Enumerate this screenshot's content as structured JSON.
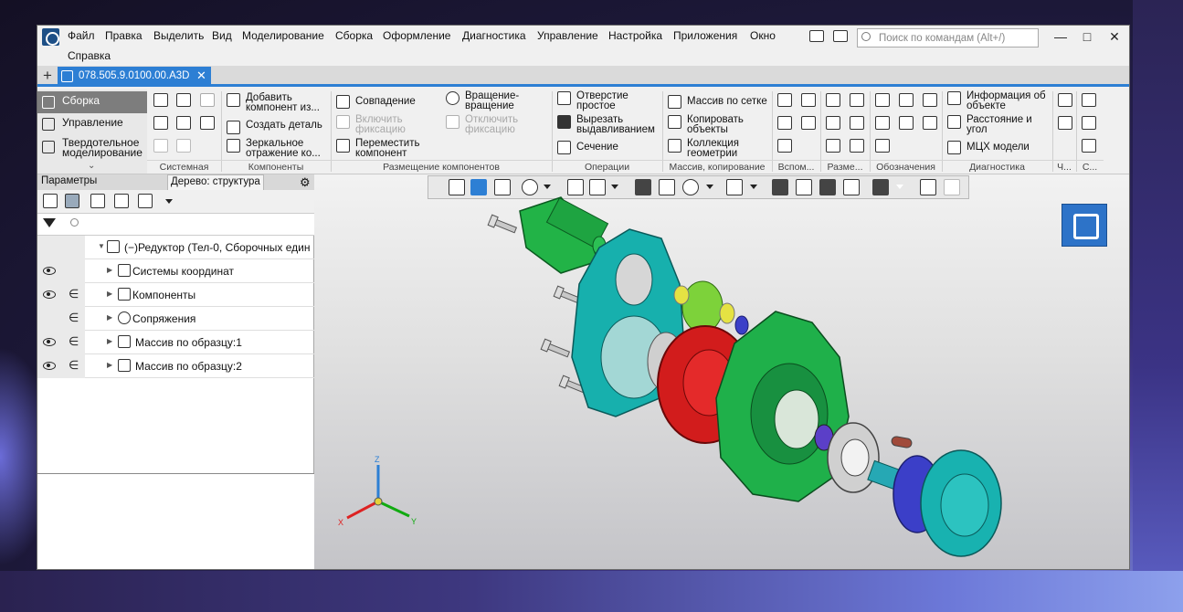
{
  "menu": {
    "items": [
      "Файл",
      "Правка",
      "Выделить",
      "Вид",
      "Моделирование",
      "Сборка",
      "Оформление",
      "Диагностика",
      "Управление",
      "Настройка",
      "Приложения",
      "Окно"
    ],
    "help": "Справка"
  },
  "search": {
    "placeholder": "Поиск по командам (Alt+/)"
  },
  "window": {
    "minimize": "—",
    "maximize": "□",
    "close": "✕"
  },
  "tabs": {
    "plus": "+",
    "document": "078.505.9.0100.00.А3D",
    "close": "✕"
  },
  "ribbon": {
    "nav": [
      {
        "label": "Сборка"
      },
      {
        "label": "Управление"
      },
      {
        "label_line1": "Твердотельное",
        "label_line2": "моделирование"
      }
    ],
    "nav_more": "⌄",
    "components": {
      "add_line1": "Добавить",
      "add_line2": "компонент из...",
      "create_part": "Создать деталь",
      "mirror_line1": "Зеркальное",
      "mirror_line2": "отражение ко..."
    },
    "placement": {
      "coincidence": "Совпадение",
      "rotation_line1": "Вращение-",
      "rotation_line2": "вращение",
      "fix_on_line1": "Включить",
      "fix_on_line2": "фиксацию",
      "fix_off_line1": "Отключить",
      "fix_off_line2": "фиксацию",
      "move_line1": "Переместить",
      "move_line2": "компонент"
    },
    "operations": {
      "hole_line1": "Отверстие",
      "hole_line2": "простое",
      "cut_line1": "Вырезать",
      "cut_line2": "выдавливанием",
      "section": "Сечение"
    },
    "arrays": {
      "grid": "Массив по сетке",
      "copy_line1": "Копировать",
      "copy_line2": "объекты",
      "collection_line1": "Коллекция",
      "collection_line2": "геометрии"
    },
    "diagnostics": {
      "info_line1": "Информация об",
      "info_line2": "объекте",
      "distance_line1": "Расстояние и",
      "distance_line2": "угол",
      "mass": "МЦХ модели"
    },
    "groups": [
      "Системная",
      "Компоненты",
      "Размещение компонентов",
      "Операции",
      "Массив, копирование",
      "Вспом...",
      "Разме...",
      "Обозначения",
      "Диагностика",
      "Ч...",
      "С..."
    ]
  },
  "panel": {
    "tabs": [
      "Параметры",
      "Дерево: структура"
    ],
    "gear": "⚙",
    "tree": {
      "root": "(−)Редуктор (Тел-0, Сборочных един",
      "rows": [
        {
          "label": "Системы координат",
          "visible": true,
          "included": false
        },
        {
          "label": "Компоненты",
          "visible": true,
          "included": true
        },
        {
          "label": "Сопряжения",
          "visible": false,
          "included": true
        },
        {
          "label": "Массив по образцу:1",
          "visible": true,
          "included": true
        },
        {
          "label": "Массив по образцу:2",
          "visible": true,
          "included": true
        }
      ],
      "eye_glyph": "",
      "include_glyph": "∈"
    }
  },
  "axes": {
    "x": "X",
    "y": "Y",
    "z": "Z"
  },
  "colors": {
    "accent": "#2d7fd4",
    "part_green": "#1fb04a",
    "part_cyan": "#18b2b0",
    "part_red": "#d21c1c",
    "part_blue": "#3b3fc8"
  }
}
